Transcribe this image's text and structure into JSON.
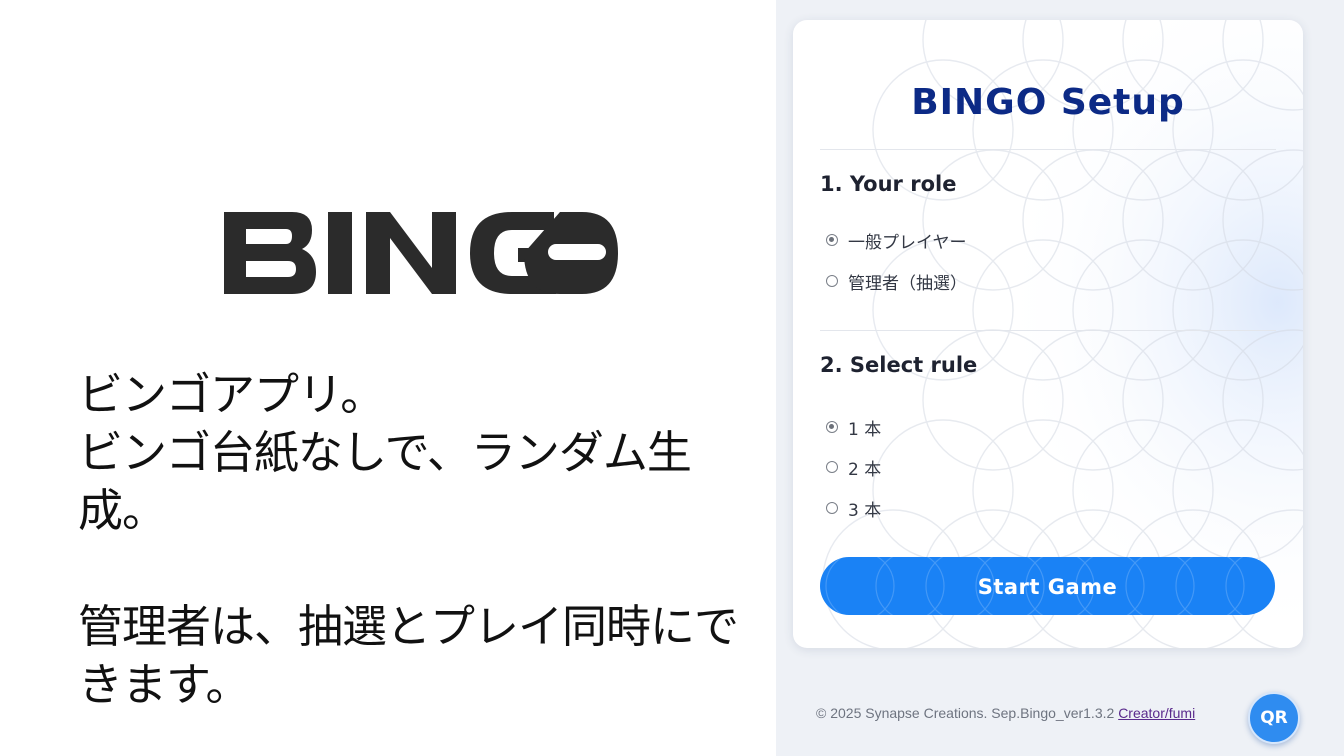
{
  "promo": {
    "logo_text": "BINGO",
    "description": "ビンゴアプリ。\nビンゴ台紙なしで、ランダム生成。\n\n管理者は、抽選とプレイ同時にできます。"
  },
  "setup": {
    "title": "BINGO Setup",
    "role_section": {
      "title": "1. Your role",
      "options": [
        {
          "label": "一般プレイヤー",
          "checked": true
        },
        {
          "label": "管理者（抽選）",
          "checked": false
        }
      ]
    },
    "rule_section": {
      "title": "2. Select rule",
      "options": [
        {
          "label": "1 本",
          "checked": true
        },
        {
          "label": "2 本",
          "checked": false
        },
        {
          "label": "3 本",
          "checked": false
        }
      ]
    },
    "start_button_label": "Start Game"
  },
  "footer": {
    "copyright": "© 2025 Synapse Creations. Sep.Bingo_ver1.3.2 ",
    "creator_link": "Creator/fumi"
  },
  "qr_button_label": "QR",
  "colors": {
    "title": "#0c2a86",
    "button": "#1a82f5",
    "panel_bg": "#eef1f6"
  }
}
